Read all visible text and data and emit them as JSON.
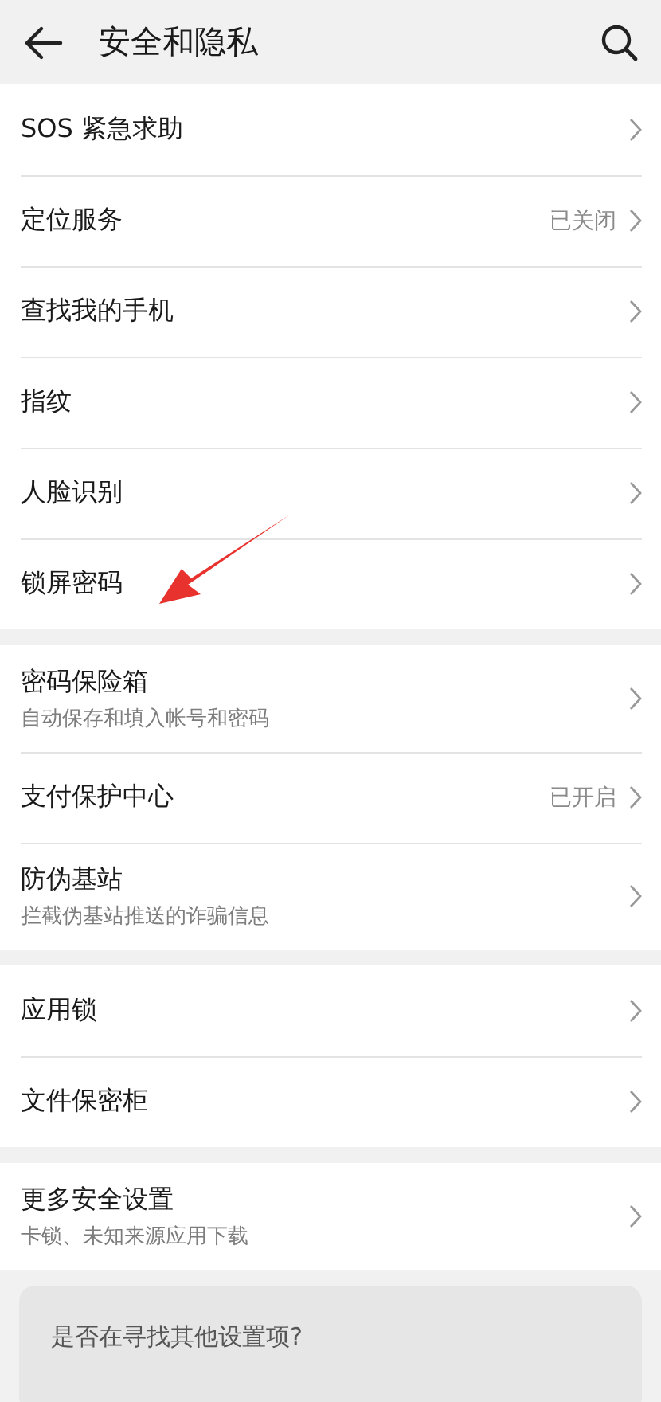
{
  "header": {
    "title": "安全和隐私"
  },
  "groups": [
    {
      "items": [
        {
          "title": "SOS 紧急求助"
        },
        {
          "title": "定位服务",
          "value": "已关闭"
        },
        {
          "title": "查找我的手机"
        },
        {
          "title": "指纹"
        },
        {
          "title": "人脸识别"
        },
        {
          "title": "锁屏密码"
        }
      ]
    },
    {
      "items": [
        {
          "title": "密码保险箱",
          "subtitle": "自动保存和填入帐号和密码"
        },
        {
          "title": "支付保护中心",
          "value": "已开启"
        },
        {
          "title": "防伪基站",
          "subtitle": "拦截伪基站推送的诈骗信息"
        }
      ]
    },
    {
      "items": [
        {
          "title": "应用锁"
        },
        {
          "title": "文件保密柜"
        }
      ]
    },
    {
      "items": [
        {
          "title": "更多安全设置",
          "subtitle": "卡锁、未知来源应用下载"
        }
      ]
    }
  ],
  "suggestion": {
    "text": "是否在寻找其他设置项?"
  }
}
